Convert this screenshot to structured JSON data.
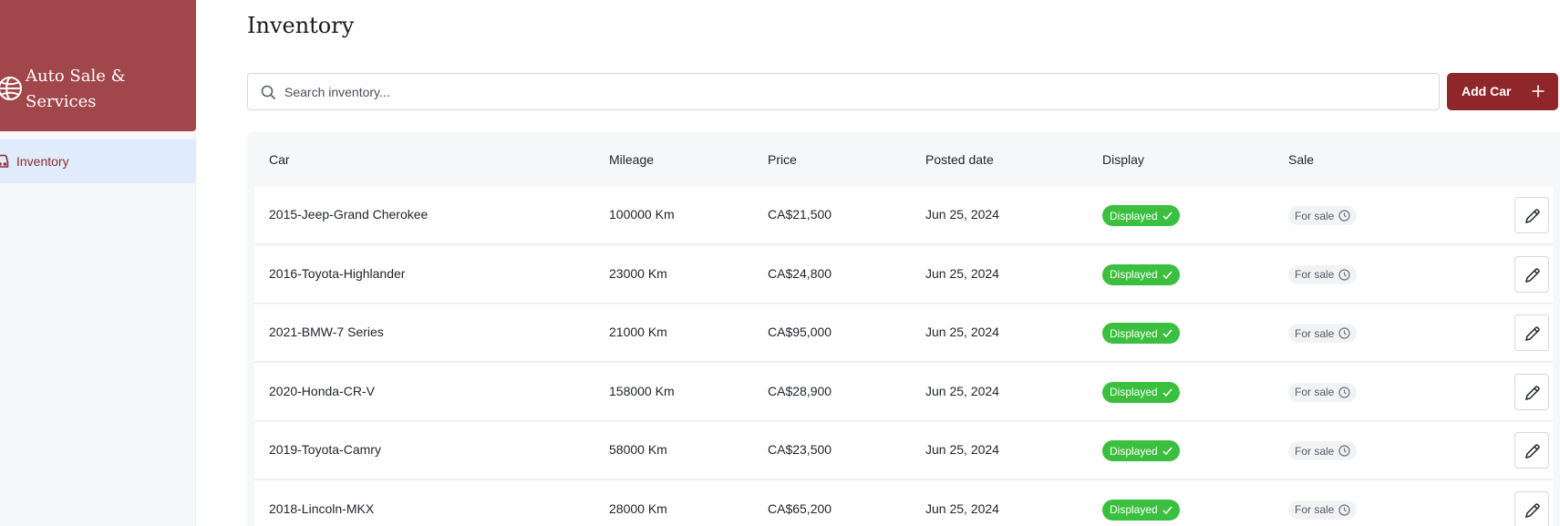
{
  "sidebar": {
    "brand_name": "Auto Sale & Services",
    "nav": [
      {
        "label": "Inventory",
        "icon": "car-icon",
        "active": true
      }
    ]
  },
  "main": {
    "title": "Inventory",
    "search": {
      "placeholder": "Search inventory...",
      "value": ""
    },
    "add_button_label": "Add Car"
  },
  "table": {
    "columns": [
      "Car",
      "Mileage",
      "Price",
      "Posted date",
      "Display",
      "Sale"
    ],
    "rows": [
      {
        "car": "2015-Jeep-Grand Cherokee",
        "mileage": "100000 Km",
        "price": "CA$21,500",
        "posted": "Jun 25, 2024",
        "display": "Displayed",
        "sale": "For sale"
      },
      {
        "car": "2016-Toyota-Highlander",
        "mileage": "23000 Km",
        "price": "CA$24,800",
        "posted": "Jun 25, 2024",
        "display": "Displayed",
        "sale": "For sale"
      },
      {
        "car": "2021-BMW-7 Series",
        "mileage": "21000 Km",
        "price": "CA$95,000",
        "posted": "Jun 25, 2024",
        "display": "Displayed",
        "sale": "For sale"
      },
      {
        "car": "2020-Honda-CR-V",
        "mileage": "158000 Km",
        "price": "CA$28,900",
        "posted": "Jun 25, 2024",
        "display": "Displayed",
        "sale": "For sale"
      },
      {
        "car": "2019-Toyota-Camry",
        "mileage": "58000 Km",
        "price": "CA$23,500",
        "posted": "Jun 25, 2024",
        "display": "Displayed",
        "sale": "For sale"
      },
      {
        "car": "2018-Lincoln-MKX",
        "mileage": "28000 Km",
        "price": "CA$65,200",
        "posted": "Jun 25, 2024",
        "display": "Displayed",
        "sale": "For sale"
      }
    ]
  },
  "colors": {
    "brand": "#a1464b",
    "accent": "#8f272a",
    "displayed_badge": "#3bbf3f",
    "active_nav_bg": "#e0ebfb"
  }
}
